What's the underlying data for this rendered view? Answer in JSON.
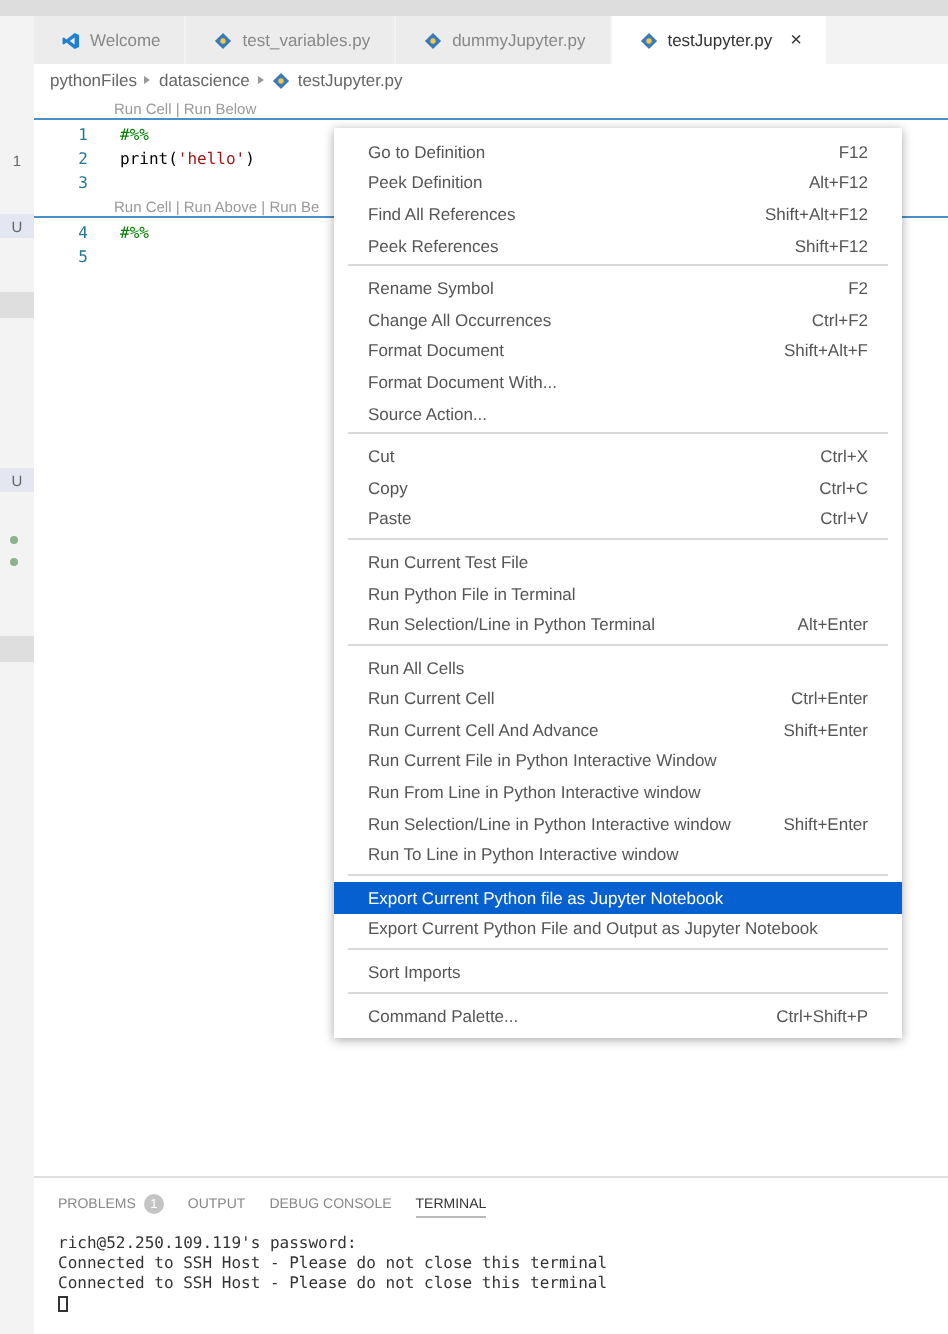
{
  "gutter_strip": [
    {
      "kind": "count",
      "text": "1"
    },
    {
      "kind": "letter",
      "text": "U"
    },
    {
      "kind": "band"
    },
    {
      "kind": "letter",
      "text": "U"
    },
    {
      "kind": "dot"
    },
    {
      "kind": "dot"
    },
    {
      "kind": "band"
    }
  ],
  "tabs": [
    {
      "label": "Welcome",
      "kind": "welcome",
      "selected": false
    },
    {
      "label": "test_variables.py",
      "kind": "file",
      "selected": false
    },
    {
      "label": "dummyJupyter.py",
      "kind": "file",
      "selected": false
    },
    {
      "label": "testJupyter.py",
      "kind": "file",
      "selected": true,
      "close": "×"
    }
  ],
  "breadcrumbs": [
    {
      "label": "pythonFiles",
      "kind": "folder"
    },
    {
      "label": "datascience",
      "kind": "folder"
    },
    {
      "label": "testJupyter.py",
      "kind": "file"
    }
  ],
  "editor": {
    "lines": [
      {
        "kind": "lens",
        "text": "Run Cell | Run Below"
      },
      {
        "kind": "code",
        "number": "1",
        "tokens": [
          {
            "kind": "comment",
            "text": "#%%"
          }
        ]
      },
      {
        "kind": "code",
        "number": "2",
        "tokens": [
          {
            "kind": "plain",
            "text": "print("
          },
          {
            "kind": "string",
            "text": "'hello'"
          },
          {
            "kind": "plain",
            "text": ")"
          }
        ]
      },
      {
        "kind": "code",
        "number": "3"
      },
      {
        "kind": "lens",
        "text": "Run Cell | Run Above | Run Be"
      },
      {
        "kind": "code",
        "number": "4",
        "tokens": [
          {
            "kind": "comment",
            "text": "#%%"
          }
        ]
      },
      {
        "kind": "code",
        "number": "5"
      }
    ]
  },
  "context_menu": {
    "groups": [
      [
        {
          "label": "Go to Definition",
          "shortcut": "F12",
          "selected": false
        },
        {
          "label": "Peek Definition",
          "shortcut": "Alt+F12",
          "selected": false
        },
        {
          "label": "Find All References",
          "shortcut": "Shift+Alt+F12",
          "selected": false
        },
        {
          "label": "Peek References",
          "shortcut": "Shift+F12",
          "selected": false
        }
      ],
      [
        {
          "label": "Rename Symbol",
          "shortcut": "F2",
          "selected": false
        },
        {
          "label": "Change All Occurrences",
          "shortcut": "Ctrl+F2",
          "selected": false
        },
        {
          "label": "Format Document",
          "shortcut": "Shift+Alt+F",
          "selected": false
        },
        {
          "label": "Format Document With...",
          "selected": false
        },
        {
          "label": "Source Action...",
          "selected": false
        }
      ],
      [
        {
          "label": "Cut",
          "shortcut": "Ctrl+X",
          "selected": false
        },
        {
          "label": "Copy",
          "shortcut": "Ctrl+C",
          "selected": false
        },
        {
          "label": "Paste",
          "shortcut": "Ctrl+V",
          "selected": false
        }
      ],
      [
        {
          "label": "Run Current Test File",
          "selected": false
        },
        {
          "label": "Run Python File in Terminal",
          "selected": false
        },
        {
          "label": "Run Selection/Line in Python Terminal",
          "shortcut": "Alt+Enter",
          "selected": false
        }
      ],
      [
        {
          "label": "Run All Cells",
          "selected": false
        },
        {
          "label": "Run Current Cell",
          "shortcut": "Ctrl+Enter",
          "selected": false
        },
        {
          "label": "Run Current Cell And Advance",
          "shortcut": "Shift+Enter",
          "selected": false
        },
        {
          "label": "Run Current File in Python Interactive Window",
          "selected": false
        },
        {
          "label": "Run From Line in Python Interactive window",
          "selected": false
        },
        {
          "label": "Run Selection/Line in Python Interactive window",
          "shortcut": "Shift+Enter",
          "selected": false
        },
        {
          "label": "Run To Line in Python Interactive window",
          "selected": false
        }
      ],
      [
        {
          "label": "Export Current Python file as Jupyter Notebook",
          "selected": true
        },
        {
          "label": "Export Current Python File and Output as Jupyter Notebook",
          "selected": false
        }
      ],
      [
        {
          "label": "Sort Imports",
          "selected": false
        }
      ],
      [
        {
          "label": "Command Palette...",
          "shortcut": "Ctrl+Shift+P",
          "selected": false
        }
      ]
    ]
  },
  "panel": {
    "tabs": [
      {
        "label": "PROBLEMS",
        "badge": "1",
        "selected": false
      },
      {
        "label": "OUTPUT",
        "selected": false
      },
      {
        "label": "DEBUG CONSOLE",
        "selected": false
      },
      {
        "label": "TERMINAL",
        "selected": true
      }
    ],
    "terminal_lines": [
      "rich@52.250.109.119's password:",
      "Connected to SSH Host - Please do not close this terminal",
      "Connected to SSH Host - Please do not close this terminal"
    ],
    "cursor": true
  }
}
